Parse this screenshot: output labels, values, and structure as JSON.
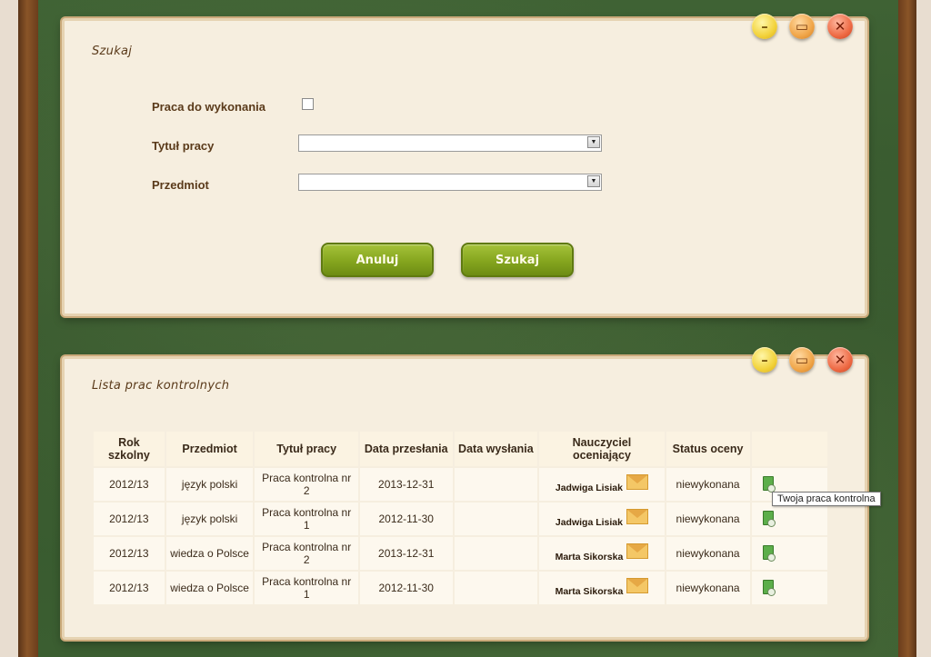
{
  "search_panel": {
    "title": "Szukaj",
    "fields": {
      "todo_label": "Praca do wykonania",
      "title_label": "Tytuł pracy",
      "subject_label": "Przedmiot",
      "todo_checked": false,
      "title_value": "",
      "subject_value": ""
    },
    "buttons": {
      "cancel": "Anuluj",
      "search": "Szukaj"
    }
  },
  "list_panel": {
    "title": "Lista prac kontrolnych",
    "columns": {
      "year": "Rok szkolny",
      "subject": "Przedmiot",
      "title": "Tytuł pracy",
      "sent_date": "Data przesłania",
      "send_date": "Data wysłania",
      "teacher": "Nauczyciel oceniający",
      "status": "Status oceny"
    },
    "rows": [
      {
        "year": "2012/13",
        "subject": "język polski",
        "title": "Praca kontrolna nr 2",
        "sent_date": "2013-12-31",
        "send_date": "",
        "teacher": "Jadwiga Lisiak",
        "status": "niewykonana"
      },
      {
        "year": "2012/13",
        "subject": "język polski",
        "title": "Praca kontrolna nr 1",
        "sent_date": "2012-11-30",
        "send_date": "",
        "teacher": "Jadwiga Lisiak",
        "status": "niewykonana"
      },
      {
        "year": "2012/13",
        "subject": "wiedza o Polsce",
        "title": "Praca kontrolna nr 2",
        "sent_date": "2013-12-31",
        "send_date": "",
        "teacher": "Marta Sikorska",
        "status": "niewykonana"
      },
      {
        "year": "2012/13",
        "subject": "wiedza o Polsce",
        "title": "Praca kontrolna nr 1",
        "sent_date": "2012-11-30",
        "send_date": "",
        "teacher": "Marta Sikorska",
        "status": "niewykonana"
      }
    ]
  },
  "tooltip": "Twoja praca kontrolna",
  "window_buttons": {
    "minimize": "–",
    "maximize": "▭",
    "close": "✕"
  },
  "colors": {
    "board": "#3b5e31",
    "panel": "#f6eedf",
    "button_green": "#85a51e"
  }
}
